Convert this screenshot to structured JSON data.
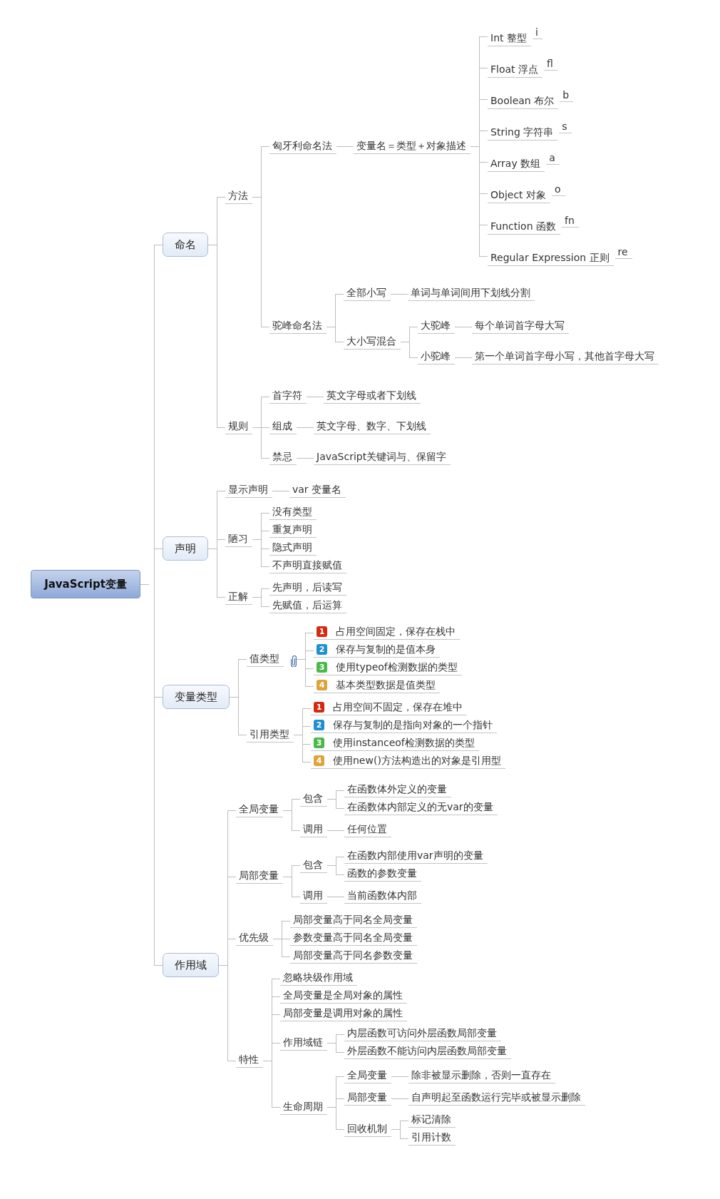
{
  "root": {
    "label": "JavaScript变量",
    "children": [
      {
        "label": "命名",
        "children": [
          {
            "label": "方法",
            "children": [
              {
                "label": "匈牙利命名法",
                "children": [
                  {
                    "label": "变量名＝类型＋对象描述",
                    "children": [
                      {
                        "label": "Int 整型",
                        "prefix": "i"
                      },
                      {
                        "label": "Float 浮点",
                        "prefix": "fl"
                      },
                      {
                        "label": "Boolean 布尔",
                        "prefix": "b"
                      },
                      {
                        "label": "String 字符串",
                        "prefix": "s"
                      },
                      {
                        "label": "Array 数组",
                        "prefix": "a"
                      },
                      {
                        "label": "Object 对象",
                        "prefix": "o"
                      },
                      {
                        "label": "Function 函数",
                        "prefix": "fn"
                      },
                      {
                        "label": "Regular Expression 正则",
                        "prefix": "re"
                      }
                    ]
                  }
                ]
              },
              {
                "label": "驼峰命名法",
                "children": [
                  {
                    "label": "全部小写",
                    "children": [
                      {
                        "label": "单词与单词间用下划线分割"
                      }
                    ]
                  },
                  {
                    "label": "大小写混合",
                    "children": [
                      {
                        "label": "大驼峰",
                        "children": [
                          {
                            "label": "每个单词首字母大写"
                          }
                        ]
                      },
                      {
                        "label": "小驼峰",
                        "children": [
                          {
                            "label": "第一个单词首字母小写，其他首字母大写"
                          }
                        ]
                      }
                    ]
                  }
                ]
              }
            ]
          },
          {
            "label": "规则",
            "children": [
              {
                "label": "首字符",
                "children": [
                  {
                    "label": "英文字母或者下划线"
                  }
                ]
              },
              {
                "label": "组成",
                "children": [
                  {
                    "label": "英文字母、数字、下划线"
                  }
                ]
              },
              {
                "label": "禁忌",
                "children": [
                  {
                    "label": "JavaScript关键词与、保留字"
                  }
                ]
              }
            ]
          }
        ]
      },
      {
        "label": "声明",
        "children": [
          {
            "label": "显示声明",
            "children": [
              {
                "label": "var 变量名"
              }
            ]
          },
          {
            "label": "陋习",
            "children": [
              {
                "label": "没有类型"
              },
              {
                "label": "重复声明"
              },
              {
                "label": "隐式声明"
              },
              {
                "label": "不声明直接赋值"
              }
            ]
          },
          {
            "label": "正解",
            "children": [
              {
                "label": "先声明，后读写"
              },
              {
                "label": "先赋值，后运算"
              }
            ]
          }
        ]
      },
      {
        "label": "变量类型",
        "children": [
          {
            "label": "值类型",
            "attachment": true,
            "children": [
              {
                "label": "占用空间固定，保存在栈中",
                "number": "1",
                "color": "#d42a12"
              },
              {
                "label": "保存与复制的是值本身",
                "number": "2",
                "color": "#1e8fd4"
              },
              {
                "label": "使用typeof检测数据的类型",
                "number": "3",
                "color": "#4cb848"
              },
              {
                "label": "基本类型数据是值类型",
                "number": "4",
                "color": "#e0a33a"
              }
            ]
          },
          {
            "label": "引用类型",
            "children": [
              {
                "label": "占用空间不固定，保存在堆中",
                "number": "1",
                "color": "#d42a12"
              },
              {
                "label": "保存与复制的是指向对象的一个指针",
                "number": "2",
                "color": "#1e8fd4"
              },
              {
                "label": "使用instanceof检测数据的类型",
                "number": "3",
                "color": "#4cb848"
              },
              {
                "label": "使用new()方法构造出的对象是引用型",
                "number": "4",
                "color": "#e0a33a"
              }
            ]
          }
        ]
      },
      {
        "label": "作用域",
        "children": [
          {
            "label": "全局变量",
            "children": [
              {
                "label": "包含",
                "children": [
                  {
                    "label": "在函数体外定义的变量"
                  },
                  {
                    "label": "在函数体内部定义的无var的变量"
                  }
                ]
              },
              {
                "label": "调用",
                "children": [
                  {
                    "label": "任何位置"
                  }
                ]
              }
            ]
          },
          {
            "label": "局部变量",
            "children": [
              {
                "label": "包含",
                "children": [
                  {
                    "label": "在函数内部使用var声明的变量"
                  },
                  {
                    "label": "函数的参数变量"
                  }
                ]
              },
              {
                "label": "调用",
                "children": [
                  {
                    "label": "当前函数体内部"
                  }
                ]
              }
            ]
          },
          {
            "label": "优先级",
            "children": [
              {
                "label": "局部变量高于同名全局变量"
              },
              {
                "label": "参数变量高于同名全局变量"
              },
              {
                "label": "局部变量高于同名参数变量"
              }
            ]
          },
          {
            "label": "特性",
            "children": [
              {
                "label": "忽略块级作用域"
              },
              {
                "label": "全局变量是全局对象的属性"
              },
              {
                "label": "局部变量是调用对象的属性"
              },
              {
                "label": "作用域链",
                "children": [
                  {
                    "label": "内层函数可访问外层函数局部变量"
                  },
                  {
                    "label": "外层函数不能访问内层函数局部变量"
                  }
                ]
              },
              {
                "label": "生命周期",
                "children": [
                  {
                    "label": "全局变量",
                    "children": [
                      {
                        "label": "除非被显示删除，否则一直存在"
                      }
                    ]
                  },
                  {
                    "label": "局部变量",
                    "children": [
                      {
                        "label": "自声明起至函数运行完毕或被显示删除"
                      }
                    ]
                  },
                  {
                    "label": "回收机制",
                    "children": [
                      {
                        "label": "标记清除"
                      },
                      {
                        "label": "引用计数"
                      }
                    ]
                  }
                ]
              }
            ]
          }
        ]
      }
    ]
  }
}
